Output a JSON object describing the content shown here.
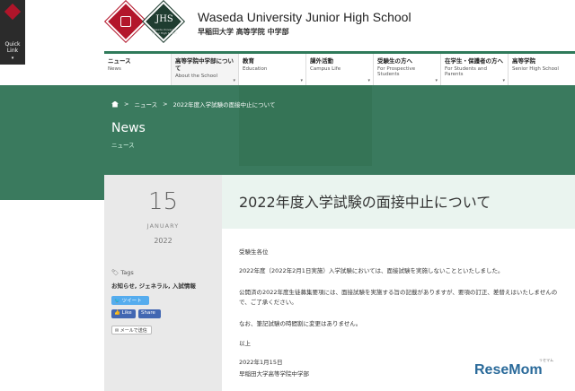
{
  "quick_link": {
    "label": "Quick Link",
    "arrow": "▾"
  },
  "header": {
    "logo_text": "JHS",
    "logo_sub": "Waseda University Junior High School",
    "title": "Waseda University Junior High School",
    "subtitle": "早稲田大学 高等学院 中学部"
  },
  "nav": {
    "items": [
      {
        "jp": "ニュース",
        "en": "News"
      },
      {
        "jp": "高等学院中学部について",
        "en": "About the School"
      },
      {
        "jp": "教育",
        "en": "Education"
      },
      {
        "jp": "課外活動",
        "en": "Campus Life"
      },
      {
        "jp": "受験生の方へ",
        "en": "For Prospective Students"
      },
      {
        "jp": "在学生・保護者の方へ",
        "en": "For Students and Parents"
      },
      {
        "jp": "高等学院",
        "en": "Senior High School"
      }
    ]
  },
  "breadcrumb": {
    "items": [
      "ニュース",
      "2022年度入学試験の面接中止について"
    ],
    "separator": ">"
  },
  "banner": {
    "title": "News",
    "subtitle": "ニュース"
  },
  "date": {
    "day": "15",
    "month": "JANUARY",
    "year": "2022"
  },
  "tags": {
    "heading": "Tags",
    "list": "お知らせ, ジェネラル, 入試情報"
  },
  "share": {
    "tweet": "ツイート",
    "like": "Like",
    "share": "Share",
    "mail": "メールで送信"
  },
  "article": {
    "title": "2022年度入学試験の面接中止について",
    "paragraphs": [
      "受験生各位",
      "2022年度（2022年2月1日実施）入学試験においては、面接試験を実施しないことといたしました。",
      "公開済の2022年度生徒募集要項には、面接試験を実施する旨の記載がありますが、要項の訂正、差替えはいたしませんので、ご了承ください。",
      "なお、筆記試験の時間割に変更はありません。",
      "以上",
      "2022年1月15日",
      "早稲田大学高等学院中学部"
    ]
  },
  "watermark": {
    "text": "ReseMom",
    "sub": "リセマム"
  },
  "colors": {
    "brand_green": "#3a7a5e",
    "brand_red": "#b3162b"
  }
}
